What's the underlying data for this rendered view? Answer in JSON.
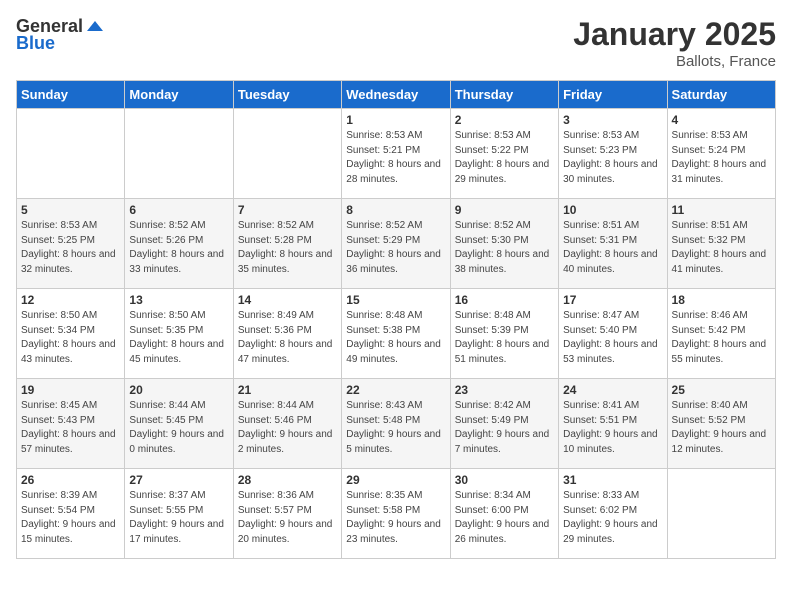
{
  "logo": {
    "text_general": "General",
    "text_blue": "Blue"
  },
  "header": {
    "month_title": "January 2025",
    "location": "Ballots, France"
  },
  "days_of_week": [
    "Sunday",
    "Monday",
    "Tuesday",
    "Wednesday",
    "Thursday",
    "Friday",
    "Saturday"
  ],
  "weeks": [
    [
      {
        "day": "",
        "sunrise": "",
        "sunset": "",
        "daylight": ""
      },
      {
        "day": "",
        "sunrise": "",
        "sunset": "",
        "daylight": ""
      },
      {
        "day": "",
        "sunrise": "",
        "sunset": "",
        "daylight": ""
      },
      {
        "day": "1",
        "sunrise": "Sunrise: 8:53 AM",
        "sunset": "Sunset: 5:21 PM",
        "daylight": "Daylight: 8 hours and 28 minutes."
      },
      {
        "day": "2",
        "sunrise": "Sunrise: 8:53 AM",
        "sunset": "Sunset: 5:22 PM",
        "daylight": "Daylight: 8 hours and 29 minutes."
      },
      {
        "day": "3",
        "sunrise": "Sunrise: 8:53 AM",
        "sunset": "Sunset: 5:23 PM",
        "daylight": "Daylight: 8 hours and 30 minutes."
      },
      {
        "day": "4",
        "sunrise": "Sunrise: 8:53 AM",
        "sunset": "Sunset: 5:24 PM",
        "daylight": "Daylight: 8 hours and 31 minutes."
      }
    ],
    [
      {
        "day": "5",
        "sunrise": "Sunrise: 8:53 AM",
        "sunset": "Sunset: 5:25 PM",
        "daylight": "Daylight: 8 hours and 32 minutes."
      },
      {
        "day": "6",
        "sunrise": "Sunrise: 8:52 AM",
        "sunset": "Sunset: 5:26 PM",
        "daylight": "Daylight: 8 hours and 33 minutes."
      },
      {
        "day": "7",
        "sunrise": "Sunrise: 8:52 AM",
        "sunset": "Sunset: 5:28 PM",
        "daylight": "Daylight: 8 hours and 35 minutes."
      },
      {
        "day": "8",
        "sunrise": "Sunrise: 8:52 AM",
        "sunset": "Sunset: 5:29 PM",
        "daylight": "Daylight: 8 hours and 36 minutes."
      },
      {
        "day": "9",
        "sunrise": "Sunrise: 8:52 AM",
        "sunset": "Sunset: 5:30 PM",
        "daylight": "Daylight: 8 hours and 38 minutes."
      },
      {
        "day": "10",
        "sunrise": "Sunrise: 8:51 AM",
        "sunset": "Sunset: 5:31 PM",
        "daylight": "Daylight: 8 hours and 40 minutes."
      },
      {
        "day": "11",
        "sunrise": "Sunrise: 8:51 AM",
        "sunset": "Sunset: 5:32 PM",
        "daylight": "Daylight: 8 hours and 41 minutes."
      }
    ],
    [
      {
        "day": "12",
        "sunrise": "Sunrise: 8:50 AM",
        "sunset": "Sunset: 5:34 PM",
        "daylight": "Daylight: 8 hours and 43 minutes."
      },
      {
        "day": "13",
        "sunrise": "Sunrise: 8:50 AM",
        "sunset": "Sunset: 5:35 PM",
        "daylight": "Daylight: 8 hours and 45 minutes."
      },
      {
        "day": "14",
        "sunrise": "Sunrise: 8:49 AM",
        "sunset": "Sunset: 5:36 PM",
        "daylight": "Daylight: 8 hours and 47 minutes."
      },
      {
        "day": "15",
        "sunrise": "Sunrise: 8:48 AM",
        "sunset": "Sunset: 5:38 PM",
        "daylight": "Daylight: 8 hours and 49 minutes."
      },
      {
        "day": "16",
        "sunrise": "Sunrise: 8:48 AM",
        "sunset": "Sunset: 5:39 PM",
        "daylight": "Daylight: 8 hours and 51 minutes."
      },
      {
        "day": "17",
        "sunrise": "Sunrise: 8:47 AM",
        "sunset": "Sunset: 5:40 PM",
        "daylight": "Daylight: 8 hours and 53 minutes."
      },
      {
        "day": "18",
        "sunrise": "Sunrise: 8:46 AM",
        "sunset": "Sunset: 5:42 PM",
        "daylight": "Daylight: 8 hours and 55 minutes."
      }
    ],
    [
      {
        "day": "19",
        "sunrise": "Sunrise: 8:45 AM",
        "sunset": "Sunset: 5:43 PM",
        "daylight": "Daylight: 8 hours and 57 minutes."
      },
      {
        "day": "20",
        "sunrise": "Sunrise: 8:44 AM",
        "sunset": "Sunset: 5:45 PM",
        "daylight": "Daylight: 9 hours and 0 minutes."
      },
      {
        "day": "21",
        "sunrise": "Sunrise: 8:44 AM",
        "sunset": "Sunset: 5:46 PM",
        "daylight": "Daylight: 9 hours and 2 minutes."
      },
      {
        "day": "22",
        "sunrise": "Sunrise: 8:43 AM",
        "sunset": "Sunset: 5:48 PM",
        "daylight": "Daylight: 9 hours and 5 minutes."
      },
      {
        "day": "23",
        "sunrise": "Sunrise: 8:42 AM",
        "sunset": "Sunset: 5:49 PM",
        "daylight": "Daylight: 9 hours and 7 minutes."
      },
      {
        "day": "24",
        "sunrise": "Sunrise: 8:41 AM",
        "sunset": "Sunset: 5:51 PM",
        "daylight": "Daylight: 9 hours and 10 minutes."
      },
      {
        "day": "25",
        "sunrise": "Sunrise: 8:40 AM",
        "sunset": "Sunset: 5:52 PM",
        "daylight": "Daylight: 9 hours and 12 minutes."
      }
    ],
    [
      {
        "day": "26",
        "sunrise": "Sunrise: 8:39 AM",
        "sunset": "Sunset: 5:54 PM",
        "daylight": "Daylight: 9 hours and 15 minutes."
      },
      {
        "day": "27",
        "sunrise": "Sunrise: 8:37 AM",
        "sunset": "Sunset: 5:55 PM",
        "daylight": "Daylight: 9 hours and 17 minutes."
      },
      {
        "day": "28",
        "sunrise": "Sunrise: 8:36 AM",
        "sunset": "Sunset: 5:57 PM",
        "daylight": "Daylight: 9 hours and 20 minutes."
      },
      {
        "day": "29",
        "sunrise": "Sunrise: 8:35 AM",
        "sunset": "Sunset: 5:58 PM",
        "daylight": "Daylight: 9 hours and 23 minutes."
      },
      {
        "day": "30",
        "sunrise": "Sunrise: 8:34 AM",
        "sunset": "Sunset: 6:00 PM",
        "daylight": "Daylight: 9 hours and 26 minutes."
      },
      {
        "day": "31",
        "sunrise": "Sunrise: 8:33 AM",
        "sunset": "Sunset: 6:02 PM",
        "daylight": "Daylight: 9 hours and 29 minutes."
      },
      {
        "day": "",
        "sunrise": "",
        "sunset": "",
        "daylight": ""
      }
    ]
  ]
}
